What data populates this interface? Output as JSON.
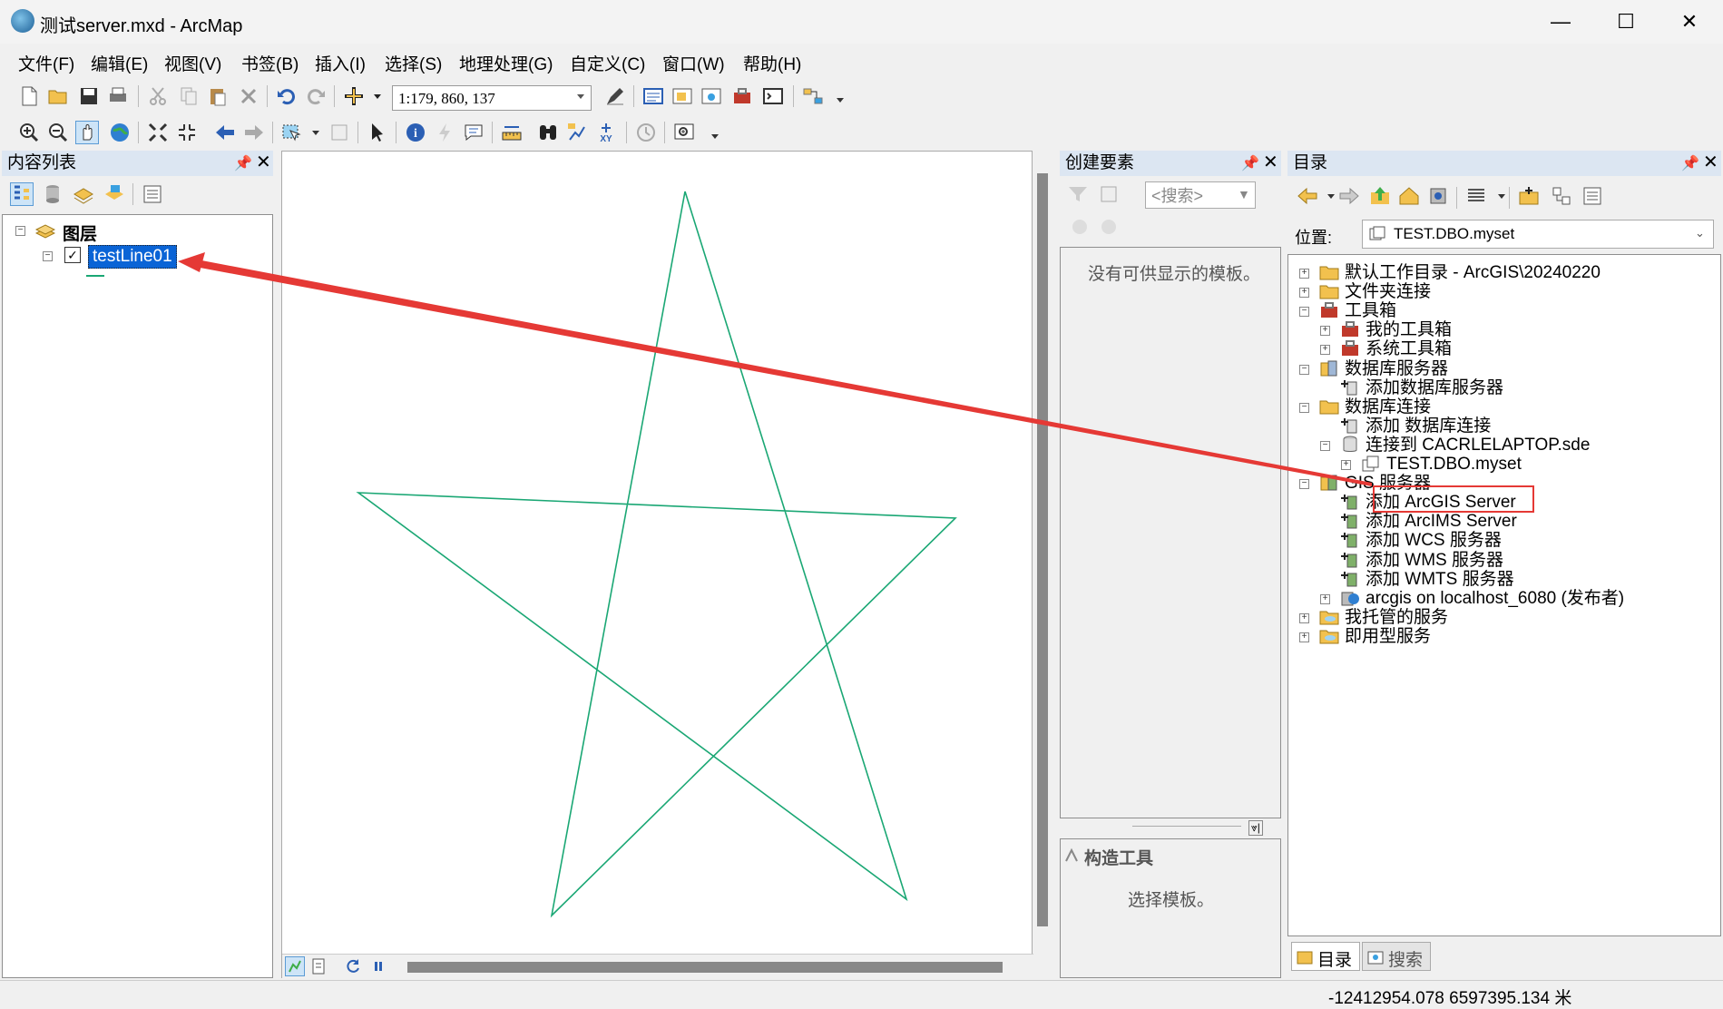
{
  "window": {
    "title": "测试server.mxd - ArcMap",
    "minimize": "—",
    "maximize": "☐",
    "close": "✕"
  },
  "menu": [
    "文件(F)",
    "编辑(E)",
    "视图(V)",
    "书签(B)",
    "插入(I)",
    "选择(S)",
    "地理处理(G)",
    "自定义(C)",
    "窗口(W)",
    "帮助(H)"
  ],
  "toolbar": {
    "scale": "1:179, 860, 137"
  },
  "toc": {
    "title": "内容列表",
    "root": "图层",
    "layer": "testLine01"
  },
  "create_features": {
    "title": "创建要素",
    "search_placeholder": "<搜索>",
    "empty_text": "没有可供显示的模板。",
    "construct_title": "构造工具",
    "construct_text": "选择模板。"
  },
  "catalog": {
    "title": "目录",
    "location_label": "位置:",
    "location_value": "TEST.DBO.myset",
    "items": [
      {
        "label": "默认工作目录 - ArcGIS\\20240220",
        "level": 0,
        "exp": "+"
      },
      {
        "label": "文件夹连接",
        "level": 0,
        "exp": "+"
      },
      {
        "label": "工具箱",
        "level": 0,
        "exp": "-"
      },
      {
        "label": "我的工具箱",
        "level": 1,
        "exp": "+"
      },
      {
        "label": "系统工具箱",
        "level": 1,
        "exp": "+"
      },
      {
        "label": "数据库服务器",
        "level": 0,
        "exp": "-"
      },
      {
        "label": "添加数据库服务器",
        "level": 1,
        "exp": ""
      },
      {
        "label": "数据库连接",
        "level": 0,
        "exp": "-"
      },
      {
        "label": "添加 数据库连接",
        "level": 1,
        "exp": ""
      },
      {
        "label": "连接到 CACRLELAPTOP.sde",
        "level": 1,
        "exp": "-"
      },
      {
        "label": "TEST.DBO.myset",
        "level": 2,
        "exp": "+"
      },
      {
        "label": "GIS 服务器",
        "level": 0,
        "exp": "-"
      },
      {
        "label": "添加 ArcGIS Server",
        "level": 1,
        "exp": ""
      },
      {
        "label": "添加 ArcIMS Server",
        "level": 1,
        "exp": ""
      },
      {
        "label": "添加 WCS 服务器",
        "level": 1,
        "exp": ""
      },
      {
        "label": "添加 WMS 服务器",
        "level": 1,
        "exp": ""
      },
      {
        "label": "添加 WMTS 服务器",
        "level": 1,
        "exp": ""
      },
      {
        "label": "arcgis on localhost_6080 (发布者)",
        "level": 1,
        "exp": "+"
      },
      {
        "label": "我托管的服务",
        "level": 0,
        "exp": "+"
      },
      {
        "label": "即用型服务",
        "level": 0,
        "exp": "+"
      }
    ],
    "tabs": [
      "目录",
      "搜索"
    ]
  },
  "status": {
    "coords": "-12412954.078  6597395.134 米"
  },
  "colors": {
    "star_line": "#1aa774",
    "highlight": "#0a64d6",
    "annotation": "#e53935",
    "panel_header": "#dce6f2"
  }
}
